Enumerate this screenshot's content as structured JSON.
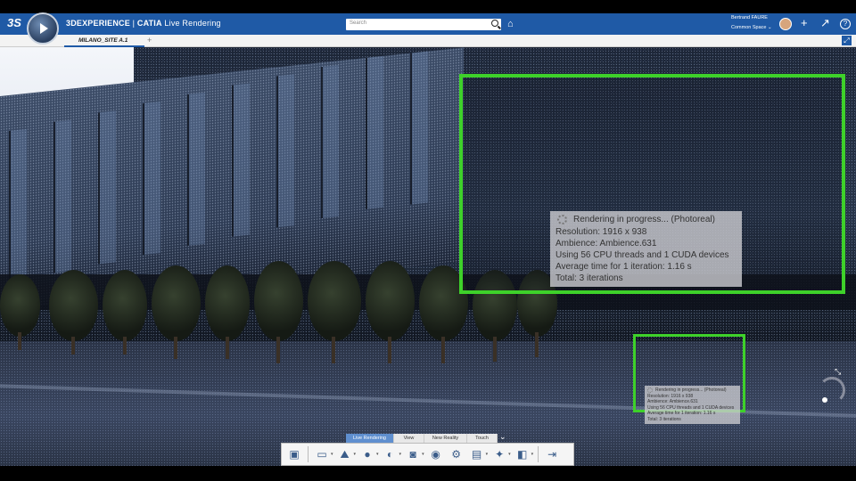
{
  "header": {
    "logo_text": "3S",
    "brand_prefix": "3DEXPERIENCE",
    "brand_separator": " | ",
    "brand_product": "CATIA",
    "brand_app": " Live Rendering",
    "search_placeholder": "Search",
    "user_name": "Bertrand FAURE",
    "space_label": "Common Space",
    "space_chevron": "⌄",
    "add_icon": "+",
    "share_icon": "↗",
    "help_icon": "?"
  },
  "tabs": {
    "active_tab": "MILANO_SITE A.1",
    "add_tab": "+"
  },
  "render_info_large": {
    "title": "Rendering in progress... (Photoreal)",
    "resolution": "Resolution: 1916 x 938",
    "ambience": "Ambience: Ambience.631",
    "threads": "Using 56 CPU threads and 1 CUDA devices",
    "avg_time": "Average time for 1 iteration: 1.16 s",
    "total": "Total: 3 iterations"
  },
  "render_info_small": {
    "title": "Rendering in progress... (Photoreal)",
    "resolution": "Resolution: 1916 x 938",
    "ambience": "Ambience: Ambience.631",
    "threads": "Using 56 CPU threads and 1 CUDA devices",
    "avg_time": "Average time for 1 iteration: 1.16 s",
    "total": "Total: 3 iterations"
  },
  "action_bar": {
    "tabs": [
      "Live Rendering",
      "View",
      "New Reality",
      "Touch"
    ],
    "active_tab_index": 0
  },
  "colors": {
    "header_blue": "#1f5aa6",
    "highlight_green": "#3ed12a"
  },
  "toolbar_icons": [
    "render-view-icon",
    "image-icon",
    "camera-ambience-icon",
    "material-sphere-icon",
    "environment-icon",
    "capture-icon",
    "record-icon",
    "settings-icon",
    "save-image-icon",
    "animation-icon",
    "stage-icon",
    "exit-icon"
  ]
}
